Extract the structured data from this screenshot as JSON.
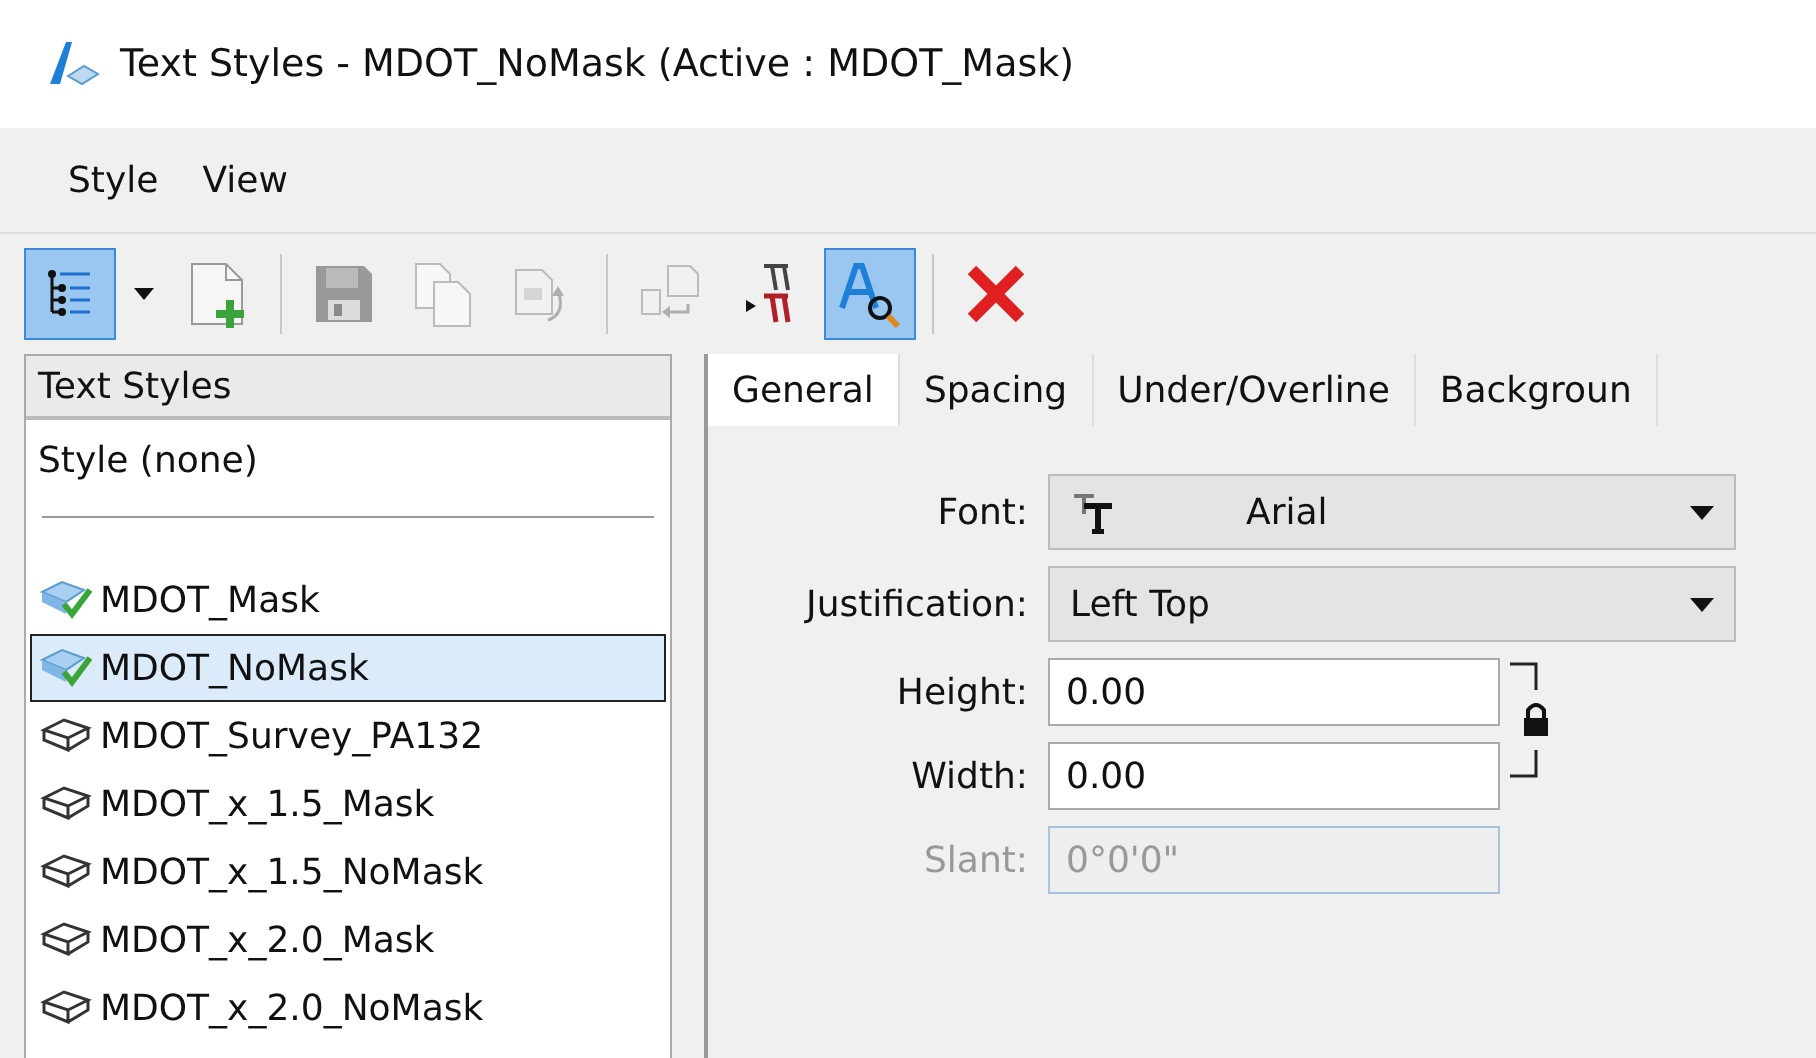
{
  "window": {
    "title": "Text Styles - MDOT_NoMask (Active : MDOT_Mask)"
  },
  "menu": [
    {
      "label": "Style"
    },
    {
      "label": "View"
    }
  ],
  "toolbar": [
    {
      "kind": "tree",
      "active": true,
      "disabled": false
    },
    {
      "kind": "caret",
      "active": false,
      "disabled": false
    },
    {
      "kind": "new",
      "active": false,
      "disabled": false
    },
    {
      "kind": "save",
      "active": false,
      "disabled": true
    },
    {
      "kind": "copy",
      "active": false,
      "disabled": true
    },
    {
      "kind": "import",
      "active": false,
      "disabled": true
    },
    {
      "kind": "export",
      "active": false,
      "disabled": true
    },
    {
      "kind": "transfer",
      "active": false,
      "disabled": false
    },
    {
      "kind": "preview",
      "active": true,
      "disabled": false
    },
    {
      "kind": "delete",
      "active": false,
      "disabled": false
    }
  ],
  "styles_panel": {
    "header": "Text Styles",
    "none_item": "Style (none)",
    "items": [
      {
        "label": "MDOT_Mask",
        "checked": true,
        "selected": false
      },
      {
        "label": "MDOT_NoMask",
        "checked": true,
        "selected": true
      },
      {
        "label": "MDOT_Survey_PA132",
        "checked": false,
        "selected": false
      },
      {
        "label": "MDOT_x_1.5_Mask",
        "checked": false,
        "selected": false
      },
      {
        "label": "MDOT_x_1.5_NoMask",
        "checked": false,
        "selected": false
      },
      {
        "label": "MDOT_x_2.0_Mask",
        "checked": false,
        "selected": false
      },
      {
        "label": "MDOT_x_2.0_NoMask",
        "checked": false,
        "selected": false
      }
    ]
  },
  "tabs": [
    {
      "label": "General",
      "selected": true
    },
    {
      "label": "Spacing",
      "selected": false
    },
    {
      "label": "Under/Overline",
      "selected": false
    },
    {
      "label": "Backgroun",
      "selected": false
    }
  ],
  "fields": [
    {
      "kind": "dropdown",
      "label": "Font:",
      "value": "Arial",
      "font_icon": true,
      "disabled": false
    },
    {
      "kind": "dropdown",
      "label": "Justification:",
      "value": "Left Top",
      "font_icon": false,
      "disabled": false
    },
    {
      "kind": "input",
      "label": "Height:",
      "value": "0.00",
      "disabled": false
    },
    {
      "kind": "input",
      "label": "Width:",
      "value": "0.00",
      "disabled": false
    },
    {
      "kind": "input",
      "label": "Slant:",
      "value": "0°0'0\"",
      "disabled": true
    }
  ],
  "lock": {
    "locked": true
  }
}
